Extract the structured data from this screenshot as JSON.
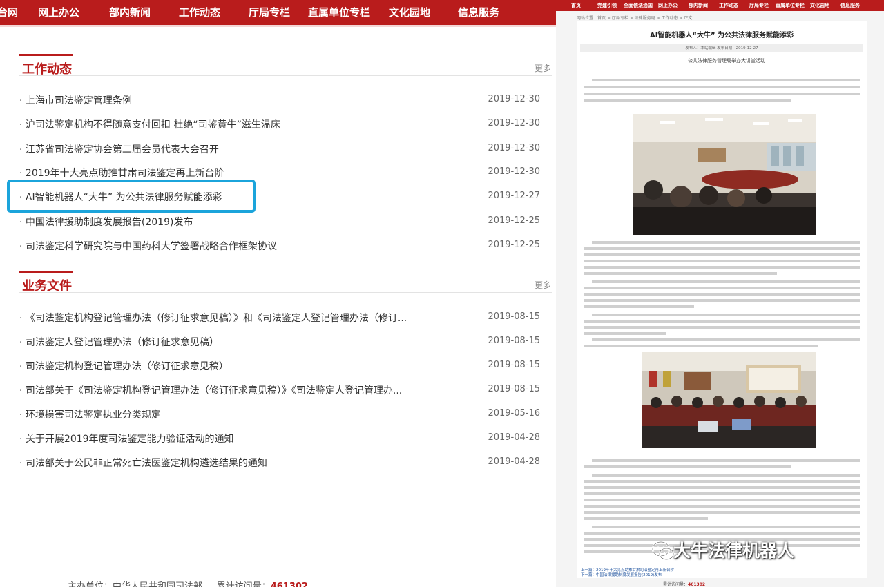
{
  "left_nav": {
    "items": [
      "台网",
      "网上办公",
      "部内新闻",
      "工作动态",
      "厅局专栏",
      "直属单位专栏",
      "文化园地",
      "信息服务"
    ]
  },
  "sections": {
    "work": {
      "title": "工作动态",
      "more": "更多",
      "items": [
        {
          "title": "上海市司法鉴定管理条例",
          "date": "2019-12-30"
        },
        {
          "title": "沪司法鉴定机构不得随意支付回扣 杜绝“司鉴黄牛”滋生温床",
          "date": "2019-12-30"
        },
        {
          "title": "江苏省司法鉴定协会第二届会员代表大会召开",
          "date": "2019-12-30"
        },
        {
          "title": "2019年十大亮点助推甘肃司法鉴定再上新台阶",
          "date": "2019-12-30"
        },
        {
          "title": "AI智能机器人“大牛” 为公共法律服务赋能添彩",
          "date": "2019-12-27"
        },
        {
          "title": "中国法律援助制度发展报告(2019)发布",
          "date": "2019-12-25"
        },
        {
          "title": "司法鉴定科学研究院与中国药科大学签署战略合作框架协议",
          "date": "2019-12-25"
        }
      ]
    },
    "docs": {
      "title": "业务文件",
      "more": "更多",
      "items": [
        {
          "title": "《司法鉴定机构登记管理办法（修订征求意见稿）》和《司法鉴定人登记管理办法（修订...",
          "date": "2019-08-15"
        },
        {
          "title": "司法鉴定人登记管理办法（修订征求意见稿）",
          "date": "2019-08-15"
        },
        {
          "title": "司法鉴定机构登记管理办法（修订征求意见稿）",
          "date": "2019-08-15"
        },
        {
          "title": "司法部关于《司法鉴定机构登记管理办法（修订征求意见稿）》《司法鉴定人登记管理办...",
          "date": "2019-08-15"
        },
        {
          "title": "环境损害司法鉴定执业分类规定",
          "date": "2019-05-16"
        },
        {
          "title": "关于开展2019年度司法鉴定能力验证活动的通知",
          "date": "2019-04-28"
        },
        {
          "title": "司法部关于公民非正常死亡法医鉴定机构遴选结果的通知",
          "date": "2019-04-28"
        }
      ]
    }
  },
  "footer": {
    "host_label": "主办单位：中华人民共和国司法部",
    "visits_label": "累计访问量：",
    "visits": "461302"
  },
  "right_nav": {
    "items": [
      "首页",
      "党建引领",
      "全面依法治国",
      "网上办公",
      "部内新闻",
      "工作动态",
      "厅局专栏",
      "直属单位专栏",
      "文化园地",
      "信息服务"
    ]
  },
  "article": {
    "breadcrumb": "网站位置：首页 > 厅局专栏 > 法律服务局 > 工作动态 > 正文",
    "title": "AI智能机器人“大牛” 为公共法律服务赋能添彩",
    "meta": "发布人：本站编辑   发布日期：2019-12-27",
    "subtitle": "——公共法律服务管理局举办大讲堂活动",
    "prev": "上一篇：2019年十大亮点助推甘肃司法鉴定再上新台阶",
    "next": "下一篇：中国法律援助制度发展报告(2019)发布"
  },
  "right_footer": {
    "visits_label": "累计访问量：",
    "visits": "461302"
  },
  "watermark": {
    "text": "大牛法律机器人",
    "icon": "wechat-icon"
  },
  "colors": {
    "brand_red": "#b91c1c",
    "highlight_blue": "#1ba4db"
  }
}
